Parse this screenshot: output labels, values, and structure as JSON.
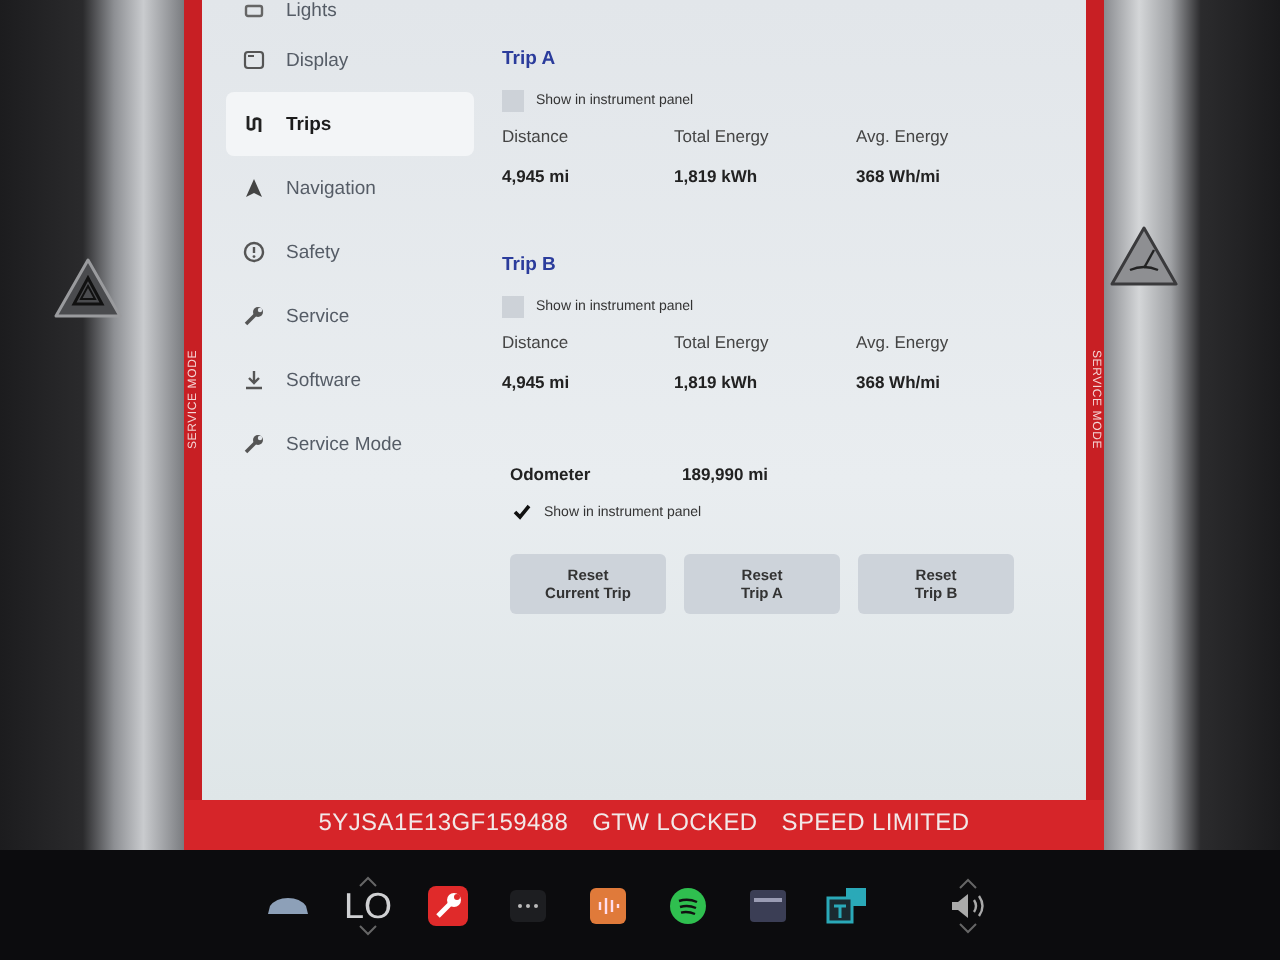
{
  "sidebar": {
    "items": [
      {
        "label": "Lights",
        "selected": false
      },
      {
        "label": "Display",
        "selected": false
      },
      {
        "label": "Trips",
        "selected": true
      },
      {
        "label": "Navigation",
        "selected": false
      },
      {
        "label": "Safety",
        "selected": false
      },
      {
        "label": "Service",
        "selected": false
      },
      {
        "label": "Software",
        "selected": false
      },
      {
        "label": "Service Mode",
        "selected": false
      }
    ]
  },
  "trips": [
    {
      "title": "Trip A",
      "show_in_panel": {
        "label": "Show in instrument panel",
        "checked": false
      },
      "columns": [
        "Distance",
        "Total Energy",
        "Avg. Energy"
      ],
      "values": [
        "4,945 mi",
        "1,819 kWh",
        "368 Wh/mi"
      ]
    },
    {
      "title": "Trip B",
      "show_in_panel": {
        "label": "Show in instrument panel",
        "checked": false
      },
      "columns": [
        "Distance",
        "Total Energy",
        "Avg. Energy"
      ],
      "values": [
        "4,945 mi",
        "1,819 kWh",
        "368 Wh/mi"
      ]
    }
  ],
  "odometer": {
    "label": "Odometer",
    "value": "189,990 mi",
    "show_in_panel": {
      "label": "Show in instrument panel",
      "checked": true
    }
  },
  "buttons": [
    "Reset\nCurrent Trip",
    "Reset\nTrip A",
    "Reset\nTrip B"
  ],
  "side_labels": [
    "SERVICE MODE",
    "SERVICE MODE"
  ],
  "status_bar": [
    "5YJSA1E13GF159488",
    "GTW LOCKED",
    "SPEED LIMITED"
  ],
  "taskbar": {
    "climate": "LO"
  }
}
